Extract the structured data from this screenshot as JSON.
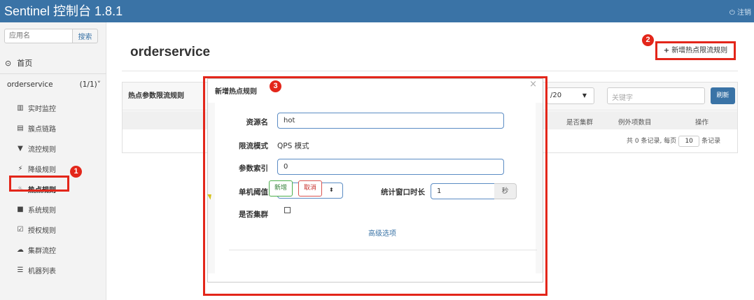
{
  "header": {
    "title": "Sentinel 控制台 1.8.1",
    "logout_label": "注销"
  },
  "sidebar": {
    "search_placeholder": "应用名",
    "search_button": "搜索",
    "home_label": "首页",
    "app": {
      "name": "orderservice",
      "count": "(1/1)"
    },
    "items": [
      {
        "label": "实时监控",
        "icon": "bar-chart-icon"
      },
      {
        "label": "簇点链路",
        "icon": "list-icon"
      },
      {
        "label": "流控规则",
        "icon": "filter-icon"
      },
      {
        "label": "降级规则",
        "icon": "flash-icon"
      },
      {
        "label": "热点规则",
        "icon": "fire-icon"
      },
      {
        "label": "系统规则",
        "icon": "lock-icon"
      },
      {
        "label": "授权规则",
        "icon": "check-icon"
      },
      {
        "label": "集群流控",
        "icon": "cloud-icon"
      },
      {
        "label": "机器列表",
        "icon": "th-list-icon"
      }
    ]
  },
  "main": {
    "title": "orderservice",
    "add_rule_button": "新增热点限流规则",
    "panel_title": "热点参数限流规则",
    "page_size": "/20",
    "keyword_placeholder": "关键字",
    "refresh_button": "刷新",
    "columns": {
      "cluster": "是否集群",
      "exceptions": "例外项数目",
      "ops": "操作"
    },
    "pager": {
      "prefix": "共 0 条记录, 每页",
      "size": "10",
      "suffix": "条记录"
    }
  },
  "modal": {
    "title": "新增热点规则",
    "resource_label": "资源名",
    "resource_value": "hot",
    "mode_label": "限流模式",
    "mode_value": "QPS 模式",
    "param_index_label": "参数索引",
    "param_index_value": "0",
    "threshold_label": "单机阈值",
    "threshold_value": "0",
    "window_label": "统计窗口时长",
    "window_value": "1",
    "window_unit": "秒",
    "cluster_label": "是否集群",
    "advanced_link": "高级选项",
    "ok_button": "新增",
    "cancel_button": "取消"
  },
  "annotations": {
    "badge1": "1",
    "badge2": "2",
    "badge3": "3"
  },
  "colors": {
    "header": "#3a73a6",
    "annotation": "#e3261a",
    "primary": "#3a73a6"
  }
}
